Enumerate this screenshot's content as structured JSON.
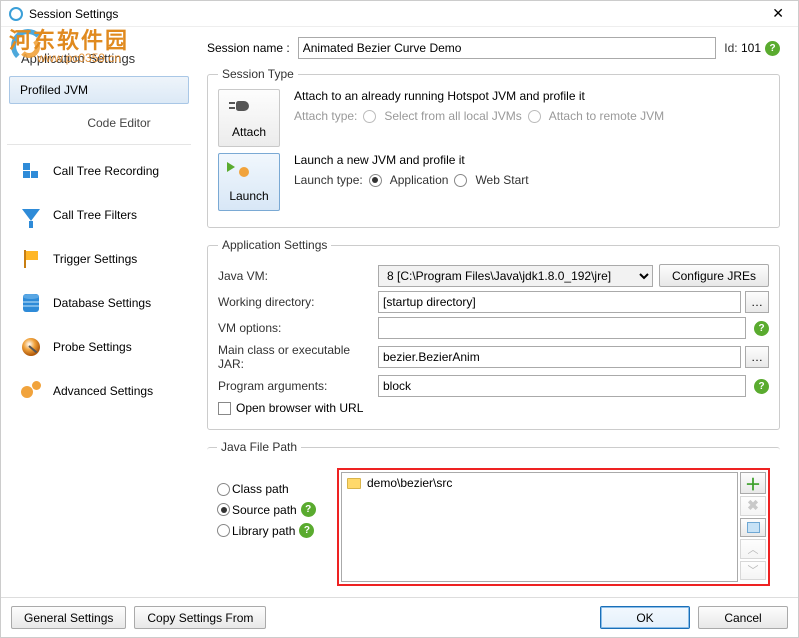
{
  "window": {
    "title": "Session Settings"
  },
  "watermark": {
    "text": "河东软件园",
    "url": "www.pc0359.cn"
  },
  "sidebar": {
    "heading": "Application Settings",
    "items": [
      {
        "label": "Profiled JVM"
      },
      {
        "label": "Code Editor"
      },
      {
        "label": "Call Tree Recording"
      },
      {
        "label": "Call Tree Filters"
      },
      {
        "label": "Trigger Settings"
      },
      {
        "label": "Database Settings"
      },
      {
        "label": "Probe Settings"
      },
      {
        "label": "Advanced Settings"
      }
    ]
  },
  "session": {
    "name_label": "Session name :",
    "name_value": "Animated Bezier Curve Demo",
    "id_label": "Id:",
    "id_value": "101"
  },
  "session_type": {
    "legend": "Session Type",
    "attach_btn": "Attach",
    "attach_title": "Attach to an already running Hotspot JVM and profile it",
    "attach_type_label": "Attach type:",
    "attach_opt1": "Select from all local JVMs",
    "attach_opt2": "Attach to remote JVM",
    "launch_btn": "Launch",
    "launch_title": "Launch a new JVM and profile it",
    "launch_type_label": "Launch type:",
    "launch_opt1": "Application",
    "launch_opt2": "Web Start"
  },
  "app": {
    "legend": "Application Settings",
    "java_vm_label": "Java VM:",
    "java_vm_value": "8 [C:\\Program Files\\Java\\jdk1.8.0_192\\jre]",
    "configure_btn": "Configure JREs",
    "working_dir_label": "Working directory:",
    "working_dir_value": "[startup directory]",
    "vm_options_label": "VM options:",
    "vm_options_value": "",
    "main_class_label": "Main class or executable JAR:",
    "main_class_value": "bezier.BezierAnim",
    "args_label": "Program arguments:",
    "args_value": "block",
    "open_browser_label": "Open browser with URL"
  },
  "java_path": {
    "legend": "Java File Path",
    "radio_class": "Class path",
    "radio_source": "Source path",
    "radio_library": "Library path",
    "entry0": "demo\\bezier\\src"
  },
  "footer": {
    "general": "General Settings",
    "copy": "Copy Settings From",
    "ok": "OK",
    "cancel": "Cancel"
  }
}
